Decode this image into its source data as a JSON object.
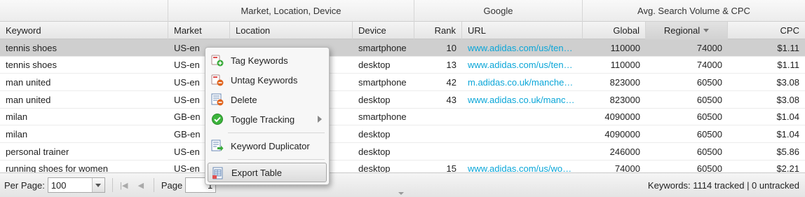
{
  "header_groups": {
    "market_location_device": "Market, Location, Device",
    "google": "Google",
    "search_volume": "Avg. Search Volume & CPC"
  },
  "columns": {
    "keyword": "Keyword",
    "market": "Market",
    "location": "Location",
    "device": "Device",
    "rank": "Rank",
    "url": "URL",
    "global": "Global",
    "regional": "Regional",
    "cpc": "CPC"
  },
  "rows": [
    {
      "keyword": "tennis shoes",
      "market": "US-en",
      "location": "",
      "device": "smartphone",
      "rank": "10",
      "url": "www.adidas.com/us/tenni...",
      "global": "110000",
      "regional": "74000",
      "cpc": "$1.11"
    },
    {
      "keyword": "tennis shoes",
      "market": "US-en",
      "location": "",
      "device": "desktop",
      "rank": "13",
      "url": "www.adidas.com/us/tenni...",
      "global": "110000",
      "regional": "74000",
      "cpc": "$1.11"
    },
    {
      "keyword": "man united",
      "market": "US-en",
      "location": "",
      "device": "smartphone",
      "rank": "42",
      "url": "m.adidas.co.uk/manchest...",
      "global": "823000",
      "regional": "60500",
      "cpc": "$3.08"
    },
    {
      "keyword": "man united",
      "market": "US-en",
      "location": "",
      "device": "desktop",
      "rank": "43",
      "url": "www.adidas.co.uk/manch...",
      "global": "823000",
      "regional": "60500",
      "cpc": "$3.08"
    },
    {
      "keyword": "milan",
      "market": "GB-en",
      "location": "",
      "device": "smartphone",
      "rank": "",
      "url": "",
      "global": "4090000",
      "regional": "60500",
      "cpc": "$1.04"
    },
    {
      "keyword": "milan",
      "market": "GB-en",
      "location": "",
      "device": "desktop",
      "rank": "",
      "url": "",
      "global": "4090000",
      "regional": "60500",
      "cpc": "$1.04"
    },
    {
      "keyword": "personal trainer",
      "market": "US-en",
      "location": "",
      "device": "desktop",
      "rank": "",
      "url": "",
      "global": "246000",
      "regional": "60500",
      "cpc": "$5.86"
    },
    {
      "keyword": "running shoes for women",
      "market": "US-en",
      "location": "",
      "device": "desktop",
      "rank": "15",
      "url": "www.adidas.com/us/wom...",
      "global": "74000",
      "regional": "60500",
      "cpc": "$2.21"
    }
  ],
  "context_menu": {
    "tag": "Tag Keywords",
    "untag": "Untag Keywords",
    "delete": "Delete",
    "toggle": "Toggle Tracking",
    "duplicator": "Keyword Duplicator",
    "export": "Export Table"
  },
  "footer": {
    "per_page_label": "Per Page:",
    "per_page_value": "100",
    "page_label": "Page",
    "page_value": "1",
    "status": "Keywords: 1114 tracked | 0 untracked"
  },
  "colors": {
    "link": "#0aa6d8",
    "selected_row": "#cfcfcf"
  }
}
